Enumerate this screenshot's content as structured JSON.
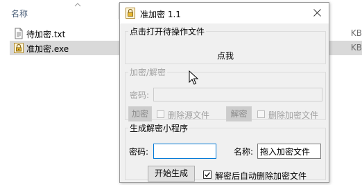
{
  "explorer": {
    "column_header": "名称",
    "files": [
      {
        "name": "待加密.txt",
        "size": "KB",
        "icon": "text-file-icon",
        "selected": false
      },
      {
        "name": "准加密.exe",
        "size": "KB",
        "icon": "lock-file-icon",
        "selected": true
      }
    ]
  },
  "dialog": {
    "title": "准加密 1.1",
    "open_group": {
      "legend": "点击打开待操作文件",
      "button_label": "点我"
    },
    "crypt_group": {
      "legend": "加密/解密",
      "password_label": "密码:",
      "password_value": "",
      "encrypt_button": "加密",
      "delete_source_label": "删除源文件",
      "decrypt_button": "解密",
      "delete_encrypted_label": "删除加密文件",
      "disabled": true
    },
    "generate_group": {
      "legend": "生成解密小程序",
      "password_label": "密码:",
      "password_value": "",
      "name_label": "名称:",
      "name_value": "拖入加密文件",
      "start_button": "开始生成",
      "auto_delete_label": "解密后自动删除加密文件",
      "auto_delete_checked": true
    }
  },
  "colors": {
    "selection": "#d9d9d9",
    "focus_border": "#0078d7",
    "header_text": "#4c607a"
  }
}
